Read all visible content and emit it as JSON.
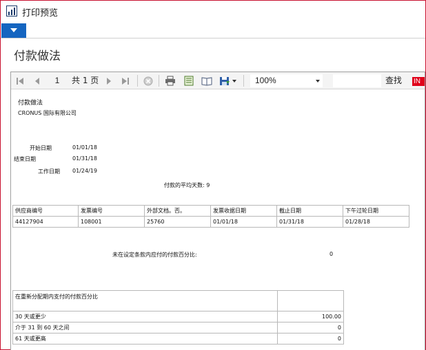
{
  "window": {
    "title": "打印预览"
  },
  "page": {
    "header": "付款做法"
  },
  "toolbar": {
    "page_current": "1",
    "page_total": "共 1 页",
    "zoom": "100%",
    "find_label": "查找",
    "lang_badge": "IN",
    "find_value": ""
  },
  "report": {
    "title": "付款做法",
    "company": "CRONUS 国际有限公司",
    "fields": [
      {
        "label": "开始日期",
        "value": "01/01/18"
      },
      {
        "label": "结束日期",
        "value": "01/31/18"
      },
      {
        "label": "工作日期",
        "value": "01/24/19"
      }
    ],
    "avg_days": "付款的平均天数: 9",
    "columns": [
      "供应商编号",
      "发票编号",
      "外部文档。否。",
      "发票收据日期",
      "截止日期",
      "下午过轮日期"
    ],
    "rows": [
      [
        "44127904",
        "108001",
        "25760",
        "01/01/18",
        "01/31/18",
        "01/28/18"
      ]
    ],
    "not_in_terms_label": "未在设定条款内应付的付款百分比:",
    "not_in_terms_value": "0",
    "pct_header": "在重新分配期内支付的付款百分比",
    "pct_rows": [
      {
        "label": "30 天或更少",
        "value": "100.00"
      },
      {
        "label": "介于 31 到 60 天之间",
        "value": "0"
      },
      {
        "label": "61 天或更高",
        "value": "0"
      }
    ]
  },
  "colors": {
    "accent": "#1565c0",
    "window_border": "#c8102e",
    "badge": "#e0001b"
  }
}
